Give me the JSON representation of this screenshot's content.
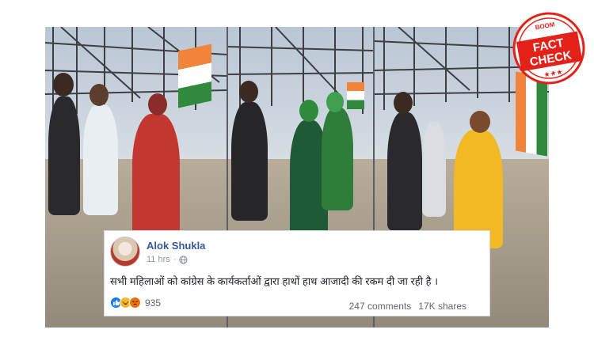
{
  "post": {
    "author": "Alok Shukla",
    "time": "11 hrs",
    "text": "सभी महिलाओं को कांग्रेस के कार्यकर्ताओं द्वारा हाथों हाथ आजादी की रकम दी जा रही है ।",
    "reaction_count": "935",
    "reactions": [
      "like-icon",
      "haha-icon",
      "angry-icon"
    ],
    "comments": "247 comments",
    "shares": "17K shares"
  },
  "stamp": {
    "brand": "BOOM",
    "line1": "FACT",
    "line2": "CHECK",
    "stars": "★★★",
    "color": "#e32119"
  },
  "colors": {
    "link": "#365899",
    "flag_saffron": "#f0843a",
    "flag_green": "#2f8a3c"
  }
}
